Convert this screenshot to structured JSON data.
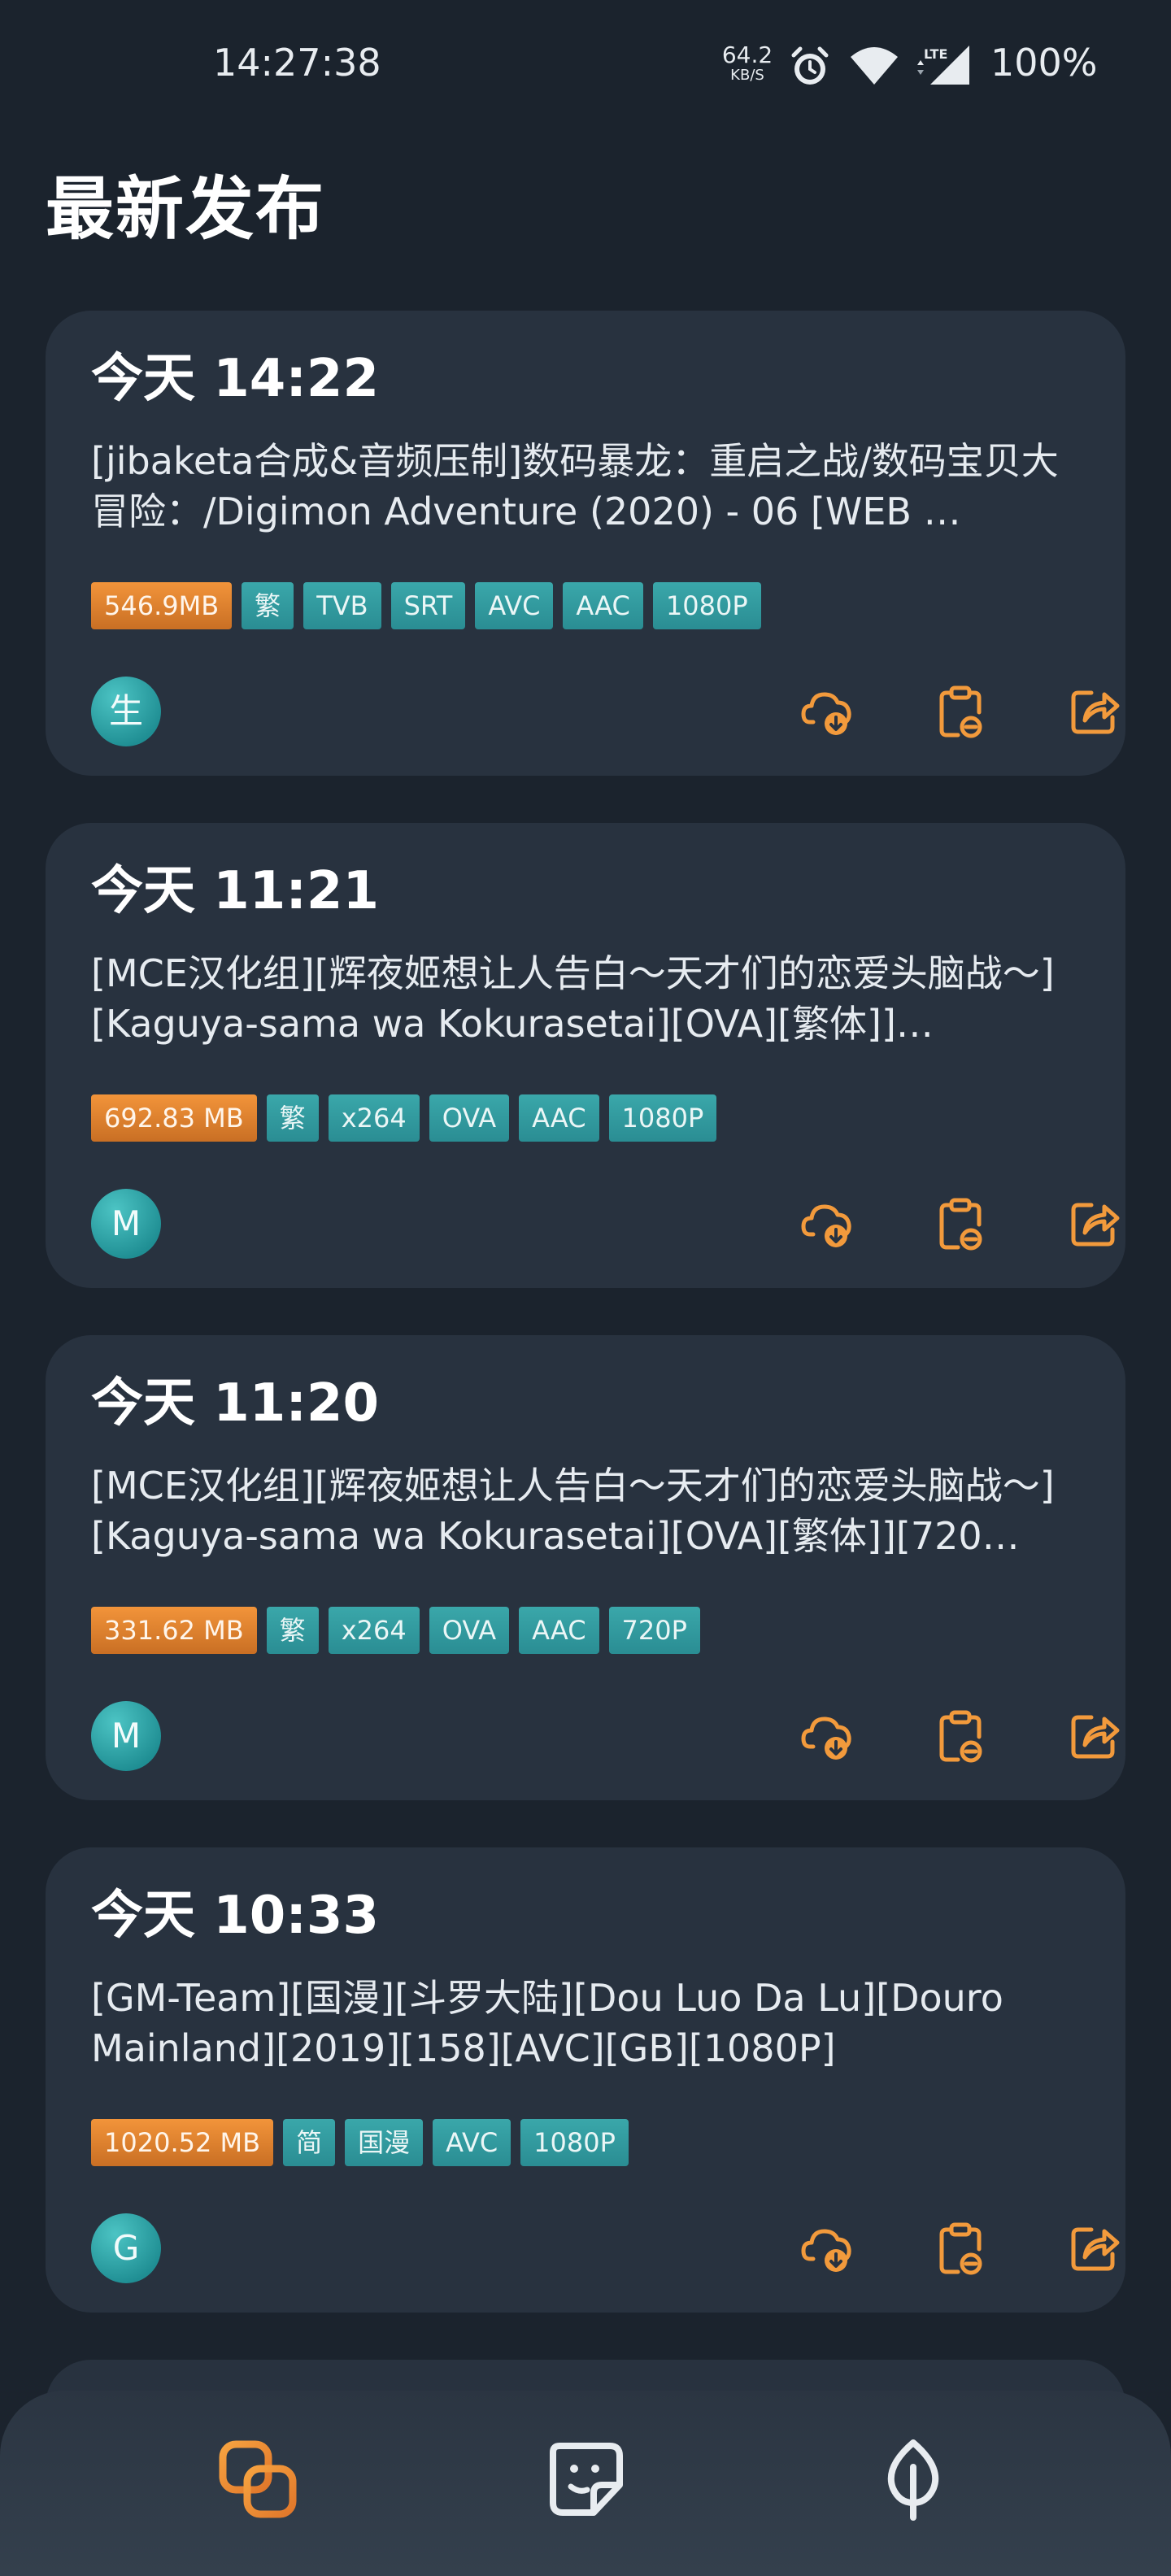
{
  "status_bar": {
    "time": "14:27:38",
    "net_speed_value": "64.2",
    "net_speed_unit": "KB/S",
    "battery": "100%",
    "icons": [
      "alarm-icon",
      "wifi-icon",
      "lte-signal-icon"
    ]
  },
  "page": {
    "title": "最新发布"
  },
  "colors": {
    "accent": "#f29a3c",
    "tag": "#2f9aa0",
    "card": "#28323f",
    "background": "#1b232d"
  },
  "cards": [
    {
      "time": "今天 14:22",
      "title": "[jibaketa合成&音频压制]数码暴龙：重启之战/数码宝贝大冒险：/Digimon Adventure (2020) - 06 [WEB …",
      "size": "546.9MB",
      "tags": [
        "繁",
        "TVB",
        "SRT",
        "AVC",
        "AAC",
        "1080P"
      ],
      "avatar": "生"
    },
    {
      "time": "今天 11:21",
      "title": "[MCE汉化组][辉夜姬想让人告白～天才们的恋爱头脑战～][Kaguya-sama wa Kokurasetai][OVA][繁体]]…",
      "size": "692.83 MB",
      "tags": [
        "繁",
        "x264",
        "OVA",
        "AAC",
        "1080P"
      ],
      "avatar": "M"
    },
    {
      "time": "今天 11:20",
      "title": "[MCE汉化组][辉夜姬想让人告白～天才们的恋爱头脑战～][Kaguya-sama wa Kokurasetai][OVA][繁体]][720…",
      "size": "331.62 MB",
      "tags": [
        "繁",
        "x264",
        "OVA",
        "AAC",
        "720P"
      ],
      "avatar": "M"
    },
    {
      "time": "今天 10:33",
      "title": "[GM-Team][国漫][斗罗大陆][Dou Luo Da Lu][Douro Mainland][2019][158][AVC][GB][1080P]",
      "size": "1020.52 MB",
      "tags": [
        "简",
        "国漫",
        "AVC",
        "1080P"
      ],
      "avatar": "G"
    }
  ],
  "card_actions": [
    "cloud-download-icon",
    "clipboard-link-icon",
    "share-icon"
  ],
  "bottom_nav": [
    {
      "icon": "linked-squares-icon",
      "active": true
    },
    {
      "icon": "sticker-face-icon",
      "active": false
    },
    {
      "icon": "leaf-icon",
      "active": false
    }
  ]
}
